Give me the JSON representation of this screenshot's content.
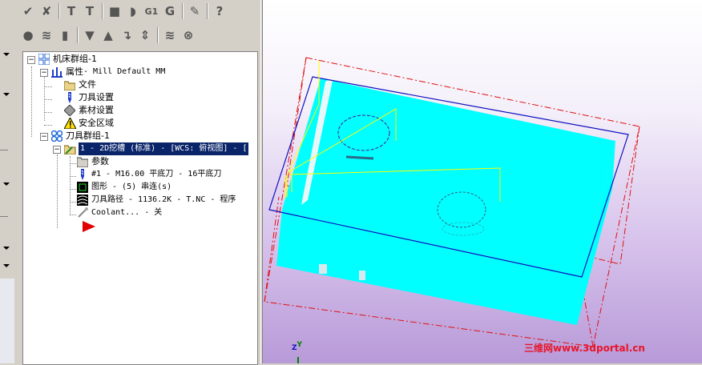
{
  "toolbar1": {
    "icons": [
      "check-all-icon",
      "check-select-icon",
      "toggle-display-icon",
      "toggle-post-icon",
      "stop-icon",
      "shape-icon",
      "g1-icon",
      "post-icon",
      "edit-icon",
      "help-icon"
    ],
    "g1_label": "G1",
    "help_label": "?"
  },
  "toolbar2": {
    "icons": [
      "lock-icon",
      "wave-icon",
      "select-icon",
      "move-down-icon",
      "move-up-icon",
      "insert-arrow-icon",
      "expand-icon",
      "highspeed-icon",
      "simulate-icon"
    ]
  },
  "tree": {
    "machine_group": "机床群组-1",
    "properties_label": "属性",
    "properties_suffix": " - Mill Default MM",
    "files": "文件",
    "tool_settings": "刀具设置",
    "stock_setup": "素材设置",
    "safety_zone": "安全区域",
    "toolpath_group": "刀具群组-1",
    "operation": "1 - 2D挖槽 (标准) - [WCS: 俯视图] - [",
    "params": "参数",
    "tool": "#1 - M16.00 平底刀 - 16平底刀",
    "geometry": "图形 - (5) 串连(s)",
    "toolpath": "刀具路径 - 1136.2K - T.NC - 程序",
    "coolant": "Coolant... - 关"
  },
  "viewport": {
    "axis_z": "Z",
    "axis_y": "Y",
    "watermark": "三维网www.3dportal.cn"
  },
  "colors": {
    "selection": "#0a246a",
    "part_cyan": "#00ffff",
    "stock_boundary": "#ff0000",
    "toolpath_yellow": "#ffff00",
    "wcs_blue": "#0000cc"
  }
}
